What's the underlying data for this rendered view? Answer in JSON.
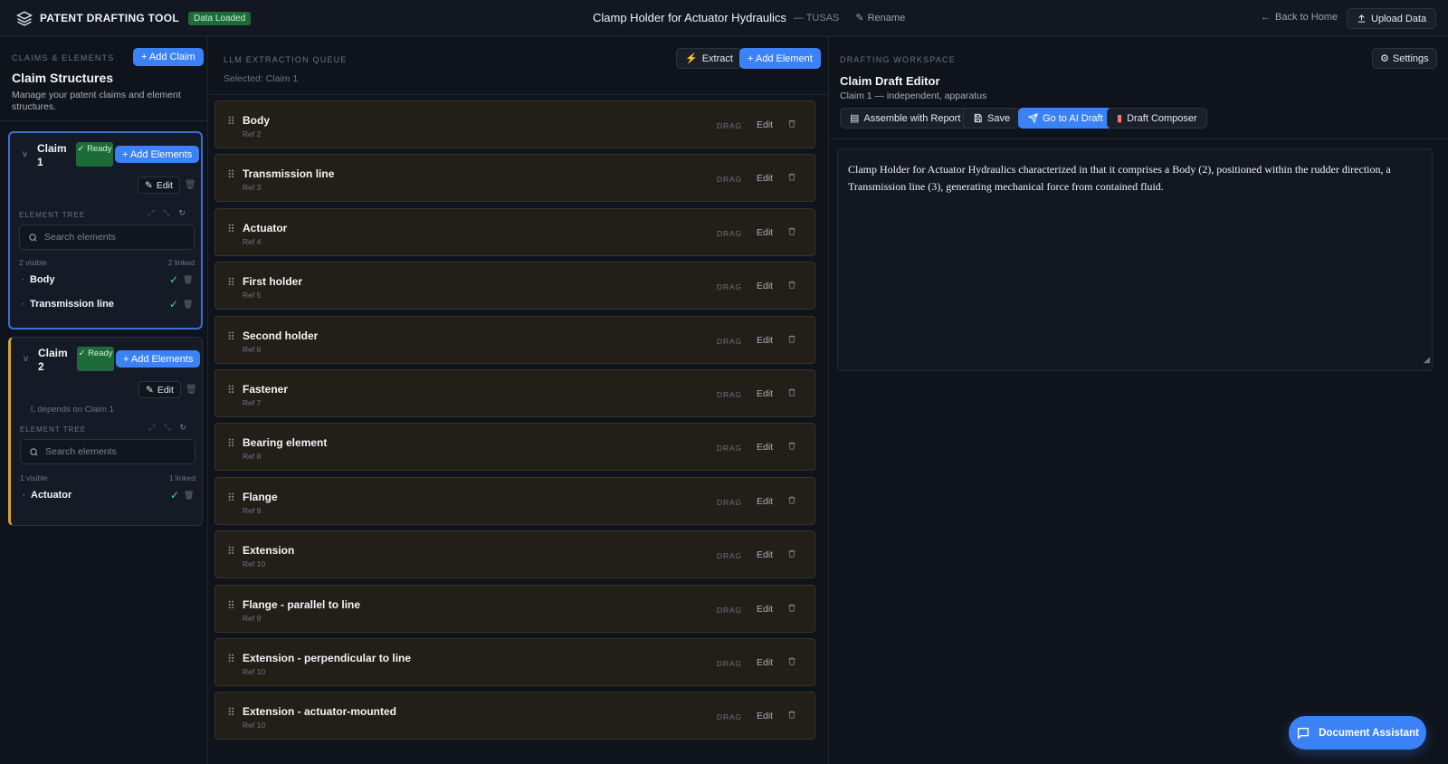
{
  "topbar": {
    "brand": "PATENT DRAFTING TOOL",
    "data_badge": "Data Loaded",
    "doc_title": "Clamp Holder for Actuator Hydraulics",
    "doc_owner": "— TUSAS",
    "rename": "Rename",
    "back_home": "Back to Home",
    "upload": "Upload Data"
  },
  "left": {
    "caption": "CLAIMS & ELEMENTS",
    "title": "Claim Structures",
    "description": "Manage your patent claims and element structures.",
    "add_claim": "+ Add Claim",
    "claims": [
      {
        "chevron": "v",
        "name": "Claim 1",
        "status": "✓ Ready",
        "add_elements": "+ Add Elements",
        "edit": "Edit",
        "tree_caption": "ELEMENT TREE",
        "search_placeholder": "Search elements",
        "visible": "2 visible",
        "linked": "2 linked",
        "elements": [
          "Body",
          "Transmission line"
        ]
      },
      {
        "chevron": "v",
        "name": "Claim 2",
        "status": "✓ Ready",
        "add_elements": "+ Add Elements",
        "edit": "Edit",
        "depends": "l, depends on Claim 1",
        "tree_caption": "ELEMENT TREE",
        "search_placeholder": "Search elements",
        "visible": "1 visible",
        "linked": "1 linked",
        "elements": [
          "Actuator"
        ]
      }
    ]
  },
  "mid": {
    "caption": "LLM EXTRACTION QUEUE",
    "selected": "Selected: Claim 1",
    "extract": "Extract",
    "add_element": "+ Add Element",
    "drag_label": "DRAG",
    "edit_label": "Edit",
    "items": [
      {
        "name": "Body",
        "ref": "Ref 2"
      },
      {
        "name": "Transmission line",
        "ref": "Ref 3"
      },
      {
        "name": "Actuator",
        "ref": "Ref 4"
      },
      {
        "name": "First holder",
        "ref": "Ref 5"
      },
      {
        "name": "Second holder",
        "ref": "Ref 6"
      },
      {
        "name": "Fastener",
        "ref": "Ref 7"
      },
      {
        "name": "Bearing element",
        "ref": "Ref 8"
      },
      {
        "name": "Flange",
        "ref": "Ref 9"
      },
      {
        "name": "Extension",
        "ref": "Ref 10"
      },
      {
        "name": "Flange - parallel to line",
        "ref": "Ref 9"
      },
      {
        "name": "Extension - perpendicular to line",
        "ref": "Ref 10"
      },
      {
        "name": "Extension - actuator-mounted",
        "ref": "Ref 10"
      }
    ]
  },
  "right": {
    "caption": "DRAFTING WORKSPACE",
    "settings": "Settings",
    "title": "Claim Draft Editor",
    "subtitle": "Claim 1 — independent, apparatus",
    "toolbar": {
      "assemble": "Assemble with Report",
      "save": "Save",
      "ai_draft": "Go to AI Draft",
      "composer": "Draft Composer"
    },
    "draft_text": "Clamp Holder for Actuator Hydraulics characterized in that it comprises a Body (2), positioned within the rudder direction, a Transmission line (3), generating mechanical force from contained fluid."
  },
  "assistant": "Document Assistant",
  "colors": {
    "accent": "#3b82f6",
    "ready": "#1e6b3a",
    "claim2_border": "#d4a43a",
    "queue_bg": "#221f18"
  }
}
